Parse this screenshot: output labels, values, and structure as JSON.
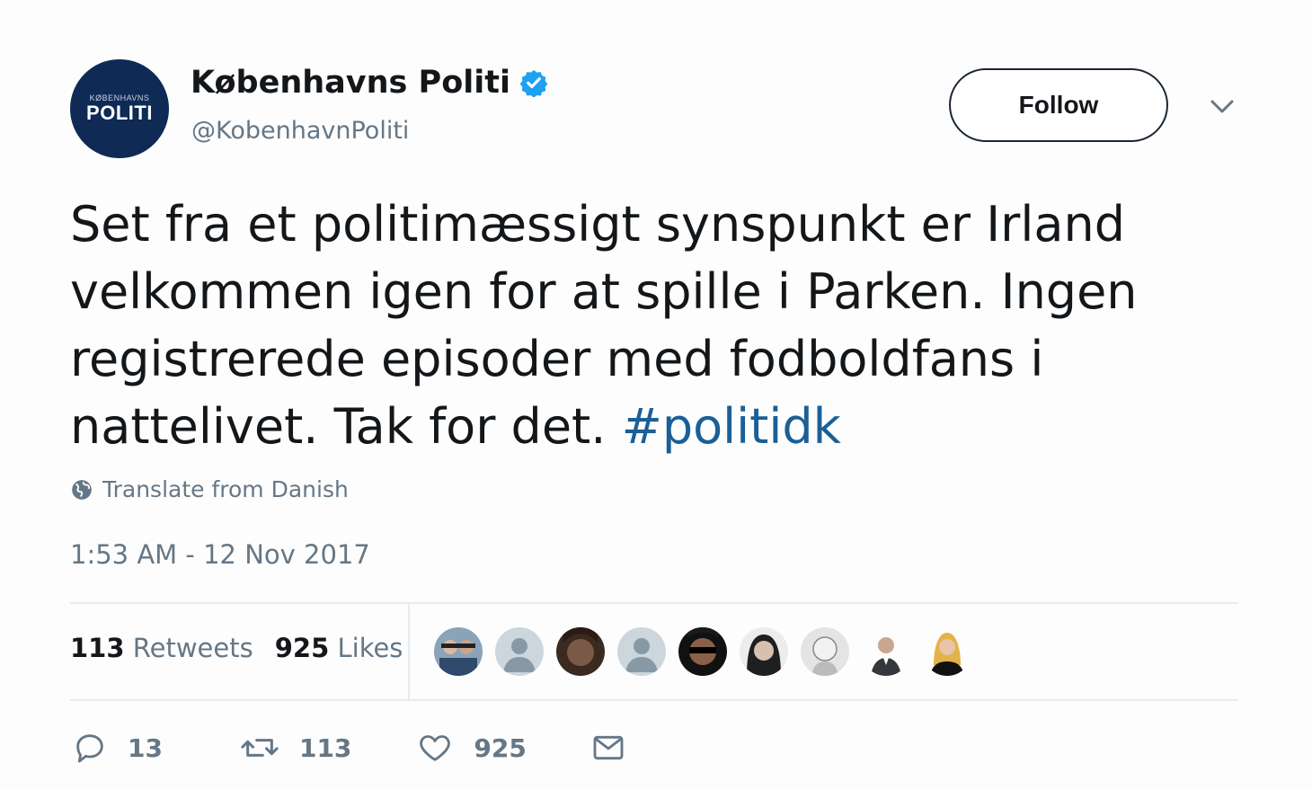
{
  "author": {
    "avatar_small_text": "KØBENHAVNS",
    "avatar_big_text": "POLITI",
    "name": "Københavns Politi",
    "handle": "@KobenhavnPoliti",
    "verified": true
  },
  "follow_label": "Follow",
  "tweet": {
    "lines": [
      "Set fra et politimæssigt synspunkt er Irland",
      "velkommen igen for at spille i Parken. Ingen",
      "registrerede episoder med fodboldfans i",
      "nattelivet. Tak for det. "
    ],
    "hashtag": "#politidk"
  },
  "translate_label": "Translate from Danish",
  "timestamp": "1:53 AM - 12 Nov 2017",
  "stats": {
    "retweets_count": "113",
    "retweets_label": "Retweets",
    "likes_count": "925",
    "likes_label": "Likes"
  },
  "likers": [
    {
      "icon": "group-photo"
    },
    {
      "icon": "default-avatar"
    },
    {
      "icon": "dark-photo"
    },
    {
      "icon": "default-avatar"
    },
    {
      "icon": "sunglasses-photo"
    },
    {
      "icon": "woman-photo"
    },
    {
      "icon": "sketch-photo"
    },
    {
      "icon": "man-suit-photo"
    },
    {
      "icon": "blonde-woman-photo"
    }
  ],
  "actions": {
    "reply_count": "13",
    "retweet_count": "113",
    "like_count": "925"
  },
  "colors": {
    "brand_blue": "#1da1f2",
    "hashtag": "#1b5f96",
    "muted": "#657786",
    "text": "#14171a",
    "avatar_bg": "#0e2a55"
  }
}
